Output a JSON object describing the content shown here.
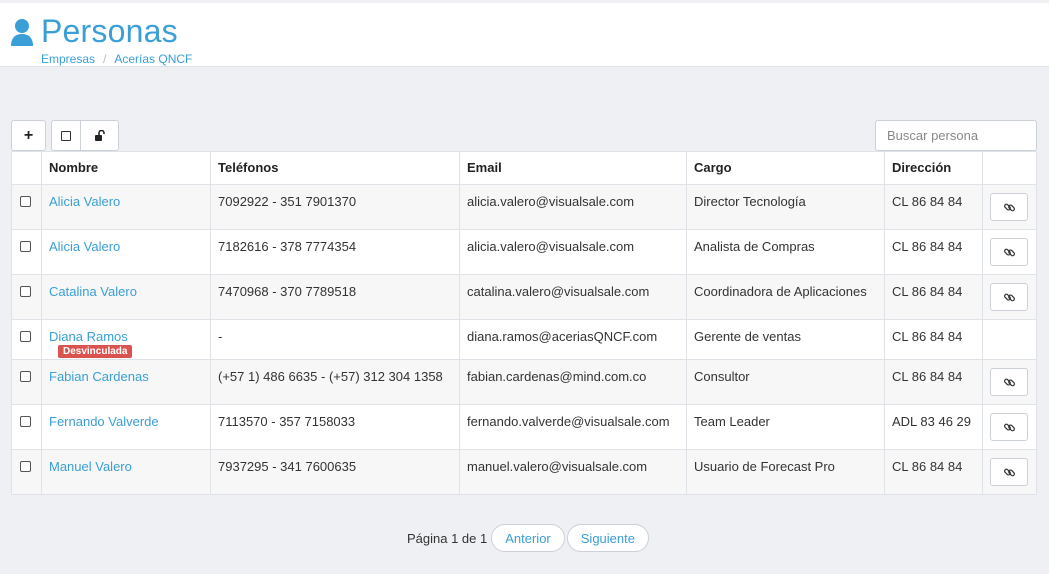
{
  "header": {
    "title": "Personas",
    "breadcrumb": [
      "Empresas",
      "Acerías QNCF"
    ],
    "breadcrumb_sep": "/"
  },
  "toolbar": {
    "add_label": "+",
    "search_placeholder": "Buscar persona"
  },
  "table": {
    "columns": [
      "Nombre",
      "Teléfonos",
      "Email",
      "Cargo",
      "Dirección"
    ],
    "rows": [
      {
        "name": "Alicia Valero",
        "phones": "7092922 - 351 7901370",
        "email": "alicia.valero@visualsale.com",
        "cargo": "Director Tecnología",
        "direccion": "CL 86 84 84",
        "badge": "",
        "has_link": true
      },
      {
        "name": "Alicia Valero",
        "phones": "7182616 - 378 7774354",
        "email": "alicia.valero@visualsale.com",
        "cargo": "Analista de Compras",
        "direccion": "CL 86 84 84",
        "badge": "",
        "has_link": true
      },
      {
        "name": "Catalina Valero",
        "phones": "7470968 - 370 7789518",
        "email": "catalina.valero@visualsale.com",
        "cargo": "Coordinadora de Aplicaciones",
        "direccion": "CL 86 84 84",
        "badge": "",
        "has_link": true
      },
      {
        "name": "Diana Ramos",
        "phones": "-",
        "email": "diana.ramos@aceriasQNCF.com",
        "cargo": "Gerente de ventas",
        "direccion": "CL 86 84 84",
        "badge": "Desvinculada",
        "has_link": false
      },
      {
        "name": "Fabian Cardenas",
        "phones": "(+57 1) 486 6635 - (+57) 312 304 1358",
        "email": "fabian.cardenas@mind.com.co",
        "cargo": "Consultor",
        "direccion": "CL 86 84 84",
        "badge": "",
        "has_link": true
      },
      {
        "name": "Fernando Valverde",
        "phones": "7113570 - 357 7158033",
        "email": "fernando.valverde@visualsale.com",
        "cargo": "Team Leader",
        "direccion": "ADL 83 46 29",
        "badge": "",
        "has_link": true
      },
      {
        "name": "Manuel Valero",
        "phones": "7937295 - 341 7600635",
        "email": "manuel.valero@visualsale.com",
        "cargo": "Usuario de Forecast Pro",
        "direccion": "CL 86 84 84",
        "badge": "",
        "has_link": true
      }
    ]
  },
  "pager": {
    "info": "Página 1 de 1",
    "prev_label": "Anterior",
    "next_label": "Siguiente"
  },
  "colors": {
    "accent": "#3a9fd6",
    "badge": "#d9534f"
  },
  "icons": {
    "title": "user-icon",
    "add": "plus-icon",
    "select_all": "checkbox-icon",
    "unlock": "unlock-icon",
    "row_action": "link-icon"
  }
}
